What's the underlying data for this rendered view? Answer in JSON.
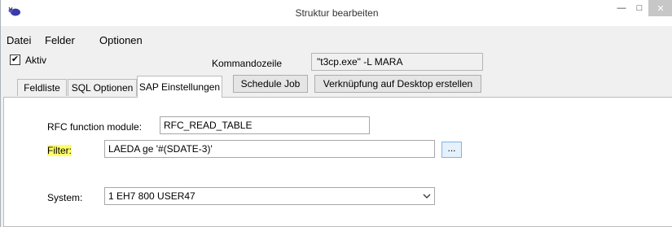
{
  "window": {
    "title": "Struktur bearbeiten",
    "icons": {
      "app": "bug-icon",
      "minimize": "minimize-icon",
      "maximize": "maximize-icon",
      "close": "close-icon"
    }
  },
  "menu": {
    "items": [
      "Datei",
      "Felder",
      "Optionen"
    ]
  },
  "options": {
    "aktiv_label": "Aktiv",
    "aktiv_checked": true,
    "command_line_label": "Kommandozeile",
    "command_line_value": "\"t3cp.exe\" -L MARA"
  },
  "tabs": [
    {
      "label": "Feldliste",
      "active": false
    },
    {
      "label": "SQL Optionen",
      "active": false
    },
    {
      "label": "SAP Einstellungen",
      "active": true
    }
  ],
  "buttons": {
    "schedule_job": "Schedule Job",
    "desktop_link": "Verknüpfung auf Desktop erstellen",
    "browse": "..."
  },
  "sap_settings": {
    "rfc_label": "RFC function module:",
    "rfc_value": "RFC_READ_TABLE",
    "filter_label": "Filter:",
    "filter_value": "LAEDA ge '#(SDATE-3)'",
    "system_label": "System:",
    "system_value": "1 EH7 800 USER47"
  },
  "colors": {
    "highlight": "#ffff66",
    "accent": "#0078d7"
  }
}
